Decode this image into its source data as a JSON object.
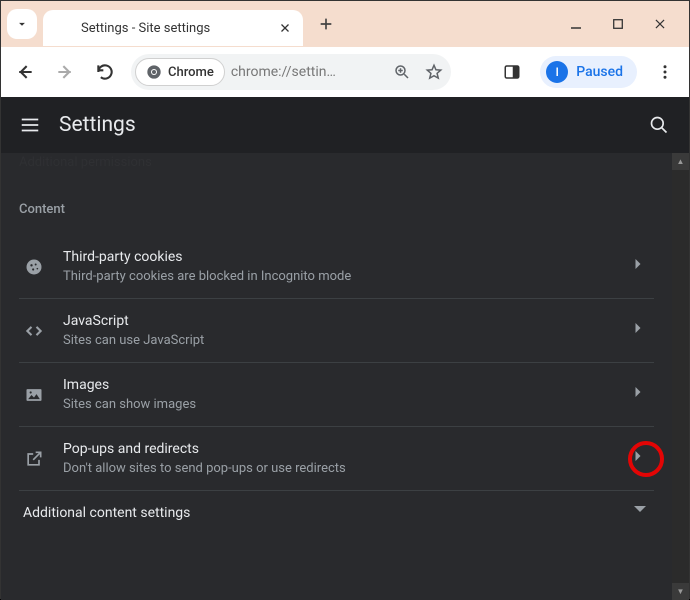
{
  "window": {
    "tab_title": "Settings - Site settings"
  },
  "toolbar": {
    "chrome_chip": "Chrome",
    "url": "chrome://settin…",
    "paused_label": "Paused",
    "avatar_initial": "I"
  },
  "settings_header": {
    "title": "Settings"
  },
  "content": {
    "scrolled_header": "Additional permissions",
    "section_label": "Content",
    "rows": [
      {
        "icon": "cookie",
        "title": "Third-party cookies",
        "sub": "Third-party cookies are blocked in Incognito mode"
      },
      {
        "icon": "code",
        "title": "JavaScript",
        "sub": "Sites can use JavaScript"
      },
      {
        "icon": "image",
        "title": "Images",
        "sub": "Sites can show images"
      },
      {
        "icon": "launch",
        "title": "Pop-ups and redirects",
        "sub": "Don't allow sites to send pop-ups or use redirects"
      }
    ],
    "additional_label": "Additional content settings"
  }
}
